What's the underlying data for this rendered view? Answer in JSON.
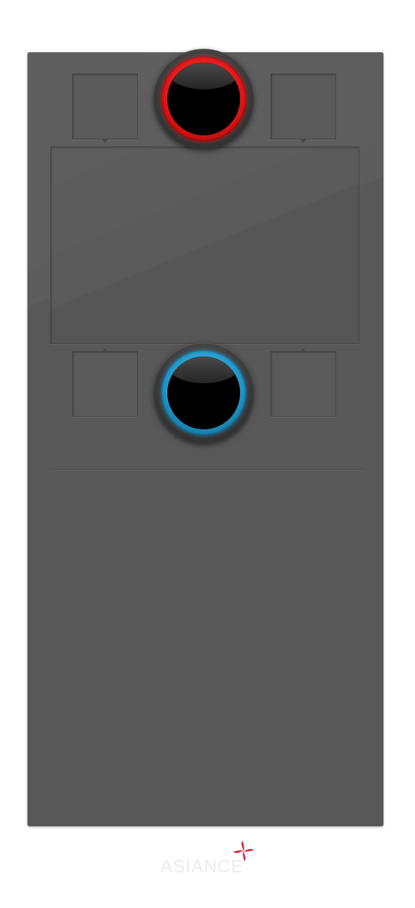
{
  "brand": {
    "logo_text": "ASIANCE",
    "tagline": "",
    "mark_color": "#e0203a"
  },
  "controls": {
    "top_knob": {
      "color": "#e01414",
      "state": "red"
    },
    "bottom_knob": {
      "color": "#1e93c5",
      "state": "blue"
    }
  },
  "colors": {
    "panel": "#585858",
    "background": "#ffffff"
  }
}
